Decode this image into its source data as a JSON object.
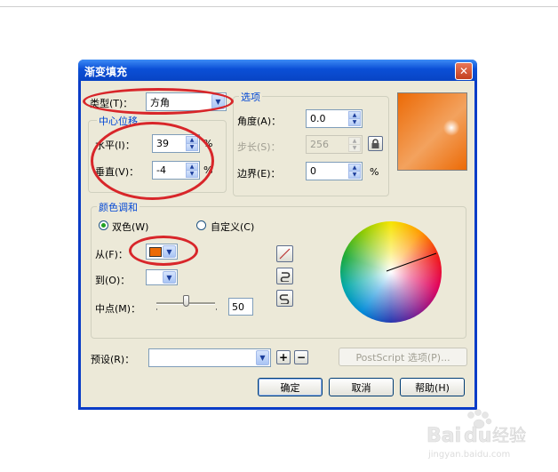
{
  "dialog": {
    "title": "渐变填充",
    "close_icon": "close-icon"
  },
  "type_row": {
    "label": "类型(T)：",
    "value": "方角"
  },
  "center_group": {
    "label": "中心位移",
    "horizontal_label": "水平(I)：",
    "horizontal_value": "39",
    "vertical_label": "垂直(V)：",
    "vertical_value": "-4",
    "unit": "%"
  },
  "options_group": {
    "label": "选项",
    "angle_label": "角度(A)：",
    "angle_value": "0.0",
    "steps_label": "步长(S)：",
    "steps_value": "256",
    "edge_label": "边界(E)：",
    "edge_value": "0",
    "unit": "%"
  },
  "colors": {
    "preview_start": "#ec6a06",
    "preview_end": "#ffffff",
    "from_swatch": "#ec6a06",
    "to_swatch": "#ffffff",
    "highlight": "#d8262a"
  },
  "blend_group": {
    "label": "颜色调和",
    "two_color_label": "双色(W)",
    "custom_label": "自定义(C)",
    "from_label": "从(F)：",
    "to_label": "到(O)：",
    "midpoint_label": "中点(M)：",
    "midpoint_value": "50"
  },
  "preset": {
    "label": "预设(R)：",
    "value": "",
    "postscript_label": "PostScript 选项(P)..."
  },
  "buttons": {
    "ok": "确定",
    "cancel": "取消",
    "help": "帮助(H)"
  }
}
